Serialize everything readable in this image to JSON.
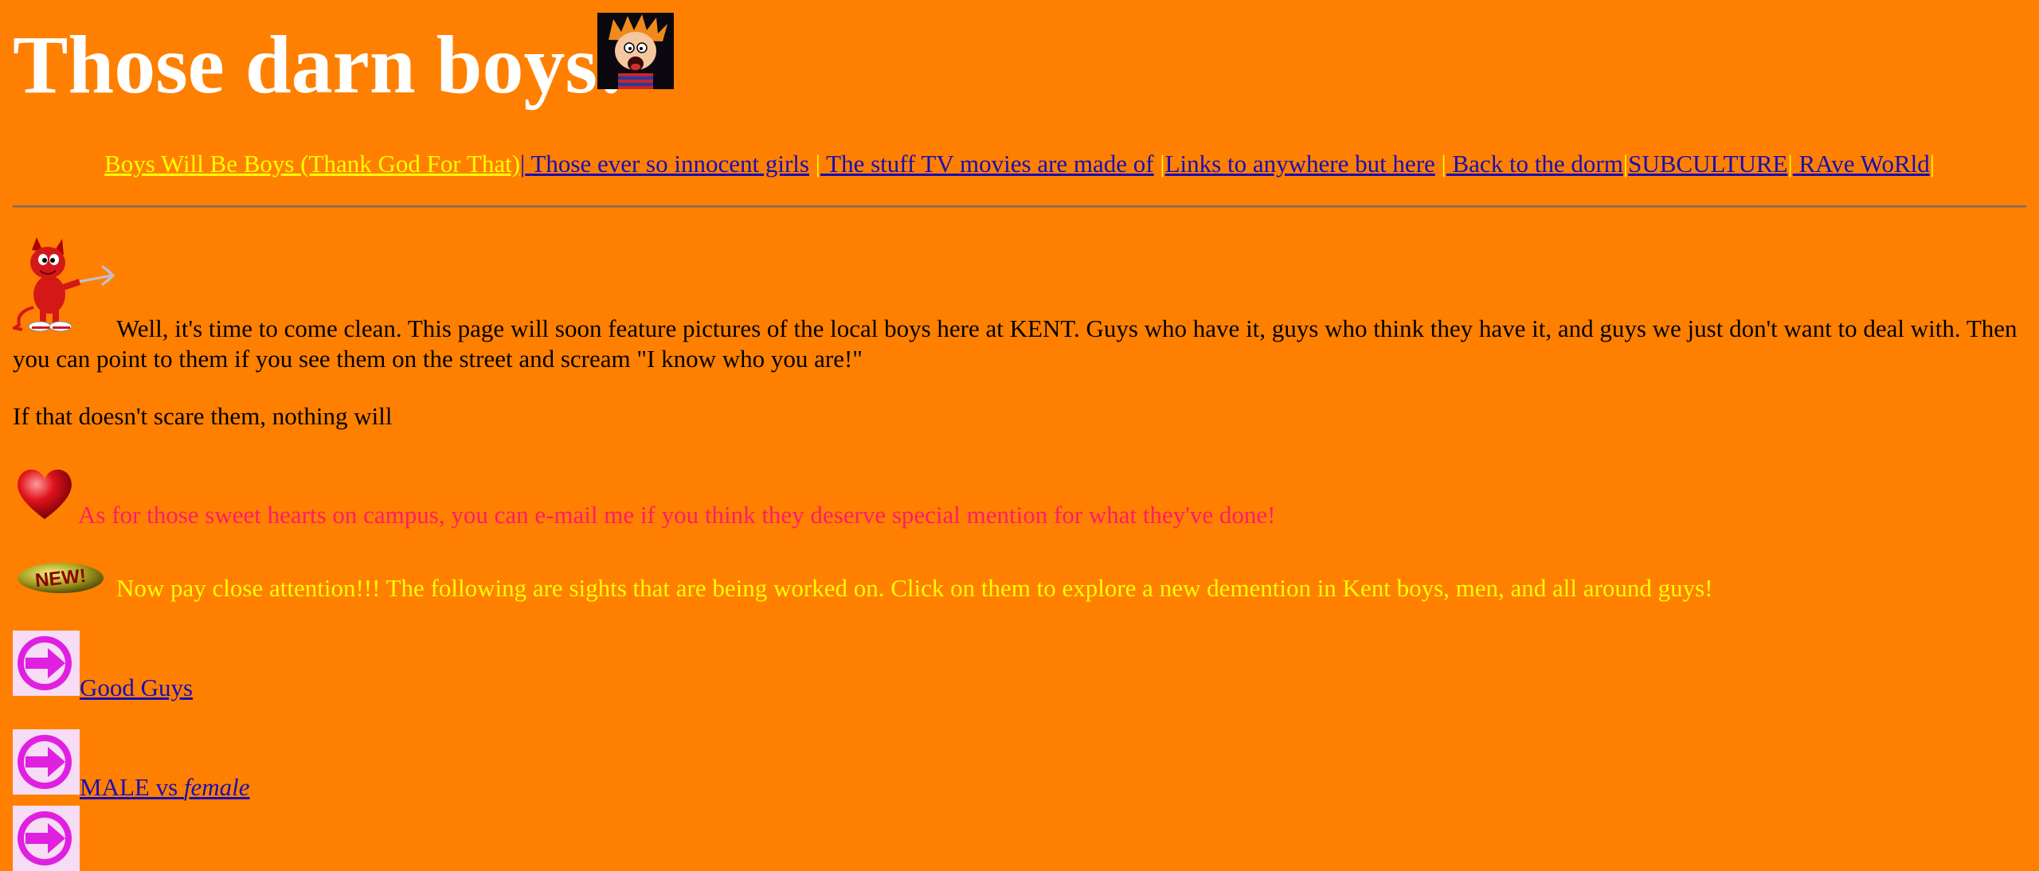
{
  "header": {
    "title": "Those darn boys!",
    "title_image": "calvin-cartoon-icon"
  },
  "nav": {
    "items": [
      {
        "label": "Boys Will Be Boys (Thank God For That)",
        "state": "visited"
      },
      {
        "label": " Those ever so innocent girls"
      },
      {
        "label": " The stuff TV movies are made of"
      },
      {
        "label": "Links to anywhere but here"
      },
      {
        "label": " Back to the dorm"
      },
      {
        "label": "SUBCULTURE"
      },
      {
        "label": " RAve WoRld"
      }
    ],
    "separator": "|"
  },
  "content": {
    "intro_icon": "devil-mascot-icon",
    "intro": "Well, it's time to come clean. This page will soon feature pictures of the local boys here at KENT. Guys who have it, guys who think they have it, and guys we just don't want to deal with. Then you can point to them if you see them on the street and scream \"I know who you are!\"",
    "scare": "If that doesn't scare them, nothing will",
    "hearts_icon": "heart-icon",
    "hearts": "As for those sweet hearts on campus, you can e-mail me if you think they deserve special mention for what they've done!",
    "new_icon": "new-badge-icon",
    "new_badge_text": "NEW!",
    "attention": "Now pay close attention!!! The following are sights that are being worked on. Click on them to explore a new demention in Kent boys, men, and all around guys!"
  },
  "links": {
    "arrow_icon": "arrow-right-icon",
    "good_guys": "Good Guys",
    "male_vs": "MALE vs ",
    "female": "female"
  },
  "colors": {
    "background": "#ff8000",
    "title": "#ffffff",
    "link": "#1a0db5",
    "visited_link": "#ffff00",
    "hearts_text": "#ff1b6b",
    "attention_text": "#ffff00"
  }
}
